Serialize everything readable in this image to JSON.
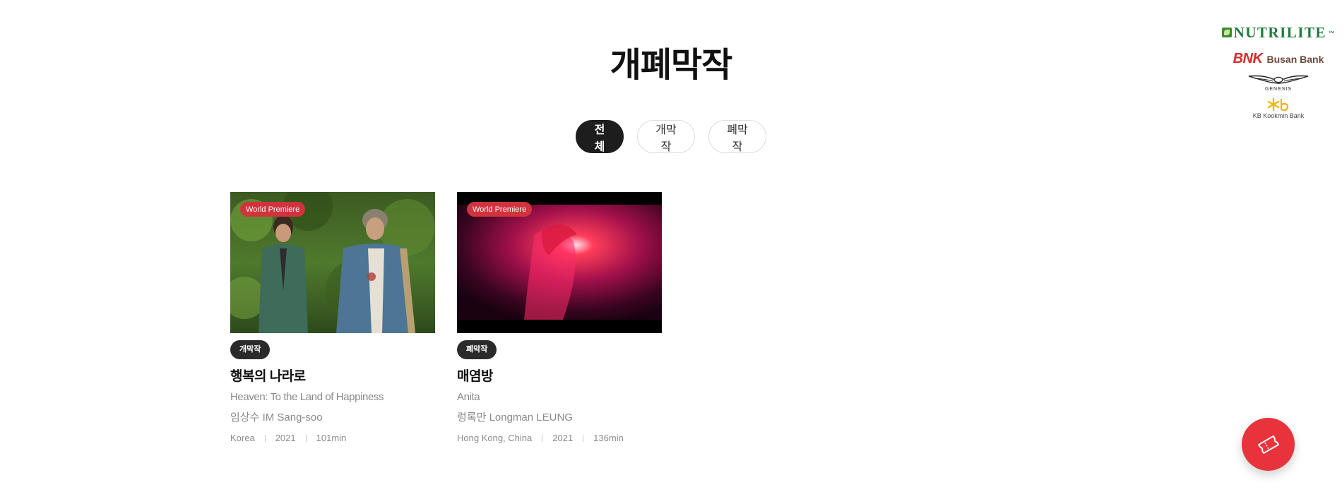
{
  "page": {
    "title": "개폐막작"
  },
  "filters": [
    {
      "label": "전체",
      "active": true
    },
    {
      "label": "개막작",
      "active": false
    },
    {
      "label": "폐막작",
      "active": false
    }
  ],
  "films": [
    {
      "premiere_badge": "World Premiere",
      "status": "개막작",
      "title": "행복의 나라로",
      "english_title": "Heaven: To the Land of Happiness",
      "director": "임상수 IM Sang-soo",
      "country": "Korea",
      "year": "2021",
      "runtime": "101min"
    },
    {
      "premiere_badge": "World Premiere",
      "status": "폐막작",
      "title": "매염방",
      "english_title": "Anita",
      "director": "렁록만 Longman LEUNG",
      "country": "Hong Kong, China",
      "year": "2021",
      "runtime": "136min"
    }
  ],
  "sponsors": {
    "nutrilite": "NUTRILITE",
    "nutrilite_tm": "™",
    "bnk_mark": "BNK",
    "bnk_name": "Busan Bank",
    "genesis": "GENESIS",
    "kb": "KB Kookmin Bank"
  },
  "colors": {
    "accent": "#e8323c",
    "premiere_badge": "#d1333d",
    "tag_dark": "#2b2b2b"
  },
  "icons": {
    "fab": "ticket-icon"
  }
}
